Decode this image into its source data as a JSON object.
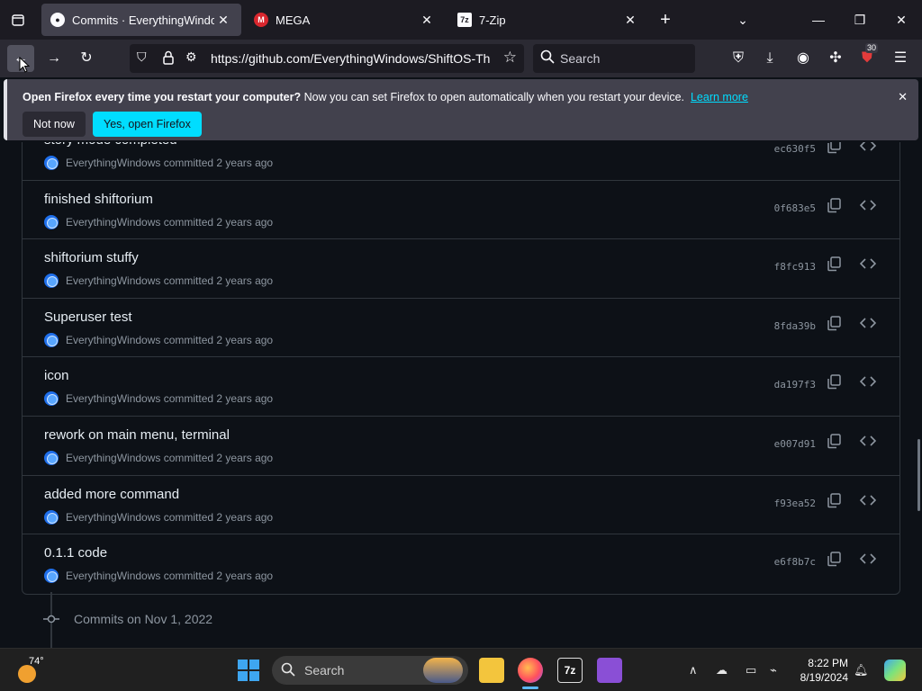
{
  "tabs": [
    {
      "label": "Commits · EverythingWindows",
      "favicon": "github-icon",
      "active": true
    },
    {
      "label": "MEGA",
      "favicon": "mega-icon",
      "active": false
    },
    {
      "label": "7-Zip",
      "favicon": "7zip-icon",
      "active": false
    }
  ],
  "navbar": {
    "url": "https://github.com/EverythingWindows/ShiftOS-Th",
    "search_placeholder": "Search",
    "extension_badge": "30"
  },
  "notification": {
    "bold_text": "Open Firefox every time you restart your computer?",
    "text": " Now you can set Firefox to open automatically when you restart your device.",
    "link": "Learn more",
    "not_now": "Not now",
    "yes": "Yes, open Firefox"
  },
  "commits": [
    {
      "title": "story mode completed",
      "author": "EverythingWindows",
      "when": "committed 2 years ago",
      "sha": "ec630f5"
    },
    {
      "title": "finished shiftorium",
      "author": "EverythingWindows",
      "when": "committed 2 years ago",
      "sha": "0f683e5"
    },
    {
      "title": "shiftorium stuffy",
      "author": "EverythingWindows",
      "when": "committed 2 years ago",
      "sha": "f8fc913"
    },
    {
      "title": "Superuser test",
      "author": "EverythingWindows",
      "when": "committed 2 years ago",
      "sha": "8fda39b"
    },
    {
      "title": "icon",
      "author": "EverythingWindows",
      "when": "committed 2 years ago",
      "sha": "da197f3"
    },
    {
      "title": "rework on main menu, terminal",
      "author": "EverythingWindows",
      "when": "committed 2 years ago",
      "sha": "e007d91"
    },
    {
      "title": "added more command",
      "author": "EverythingWindows",
      "when": "committed 2 years ago",
      "sha": "f93ea52"
    },
    {
      "title": "0.1.1 code",
      "author": "EverythingWindows",
      "when": "committed 2 years ago",
      "sha": "e6f8b7c"
    }
  ],
  "date_header": "Commits on Nov 1, 2022",
  "taskbar": {
    "weather": "74°",
    "search_placeholder": "Search",
    "time": "8:22 PM",
    "date": "8/19/2024"
  }
}
